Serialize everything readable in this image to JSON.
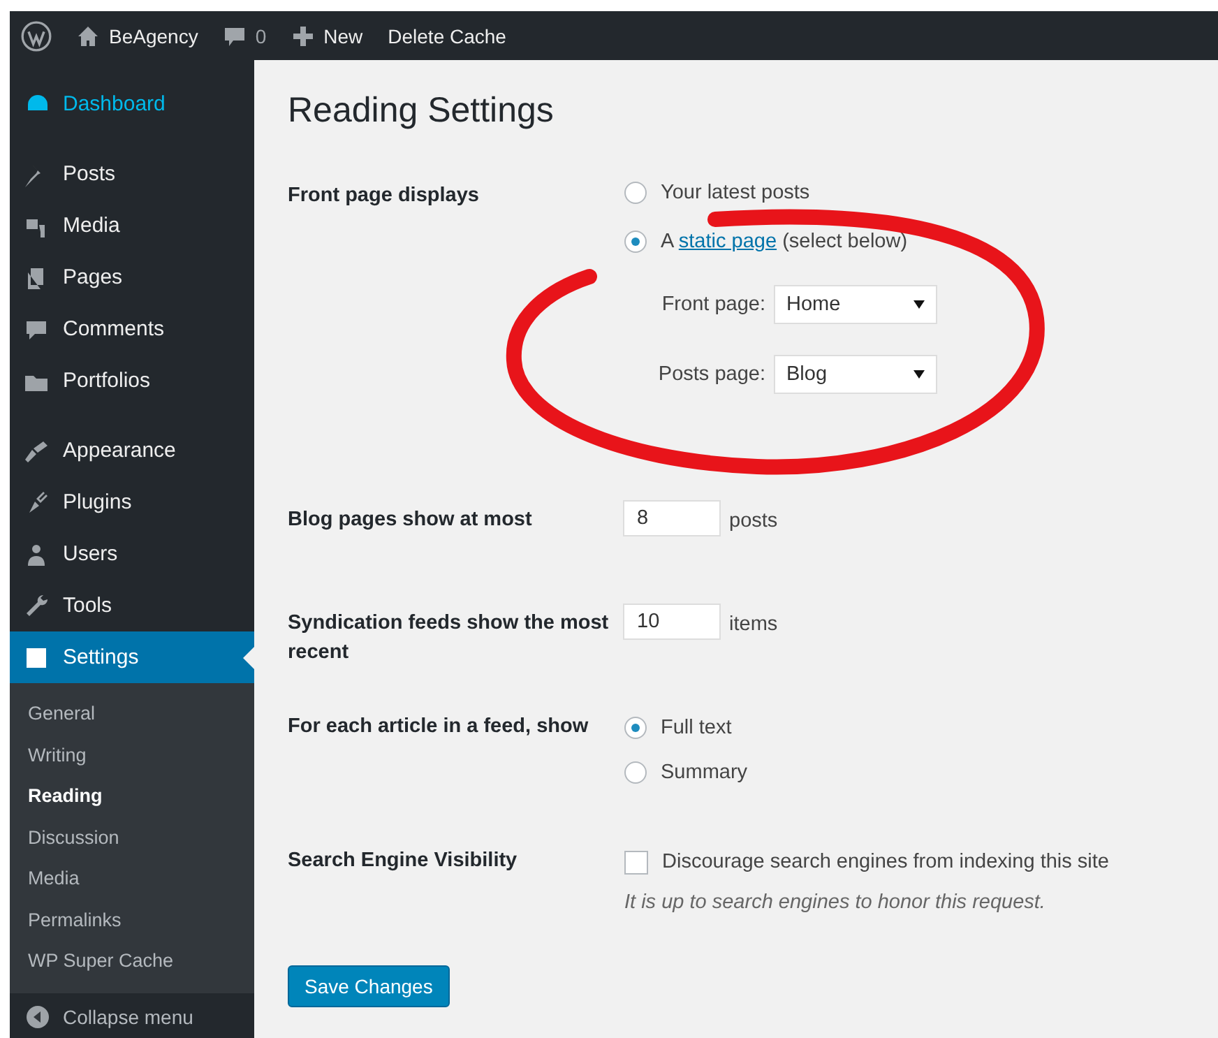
{
  "admin_bar": {
    "site": "BeAgency",
    "comments": "0",
    "new": "New",
    "items": [
      "Delete Cache"
    ]
  },
  "sidebar": {
    "groups": [
      [
        {
          "label": "Dashboard",
          "hover": true,
          "selected": false
        }
      ],
      [
        {
          "label": "Posts",
          "hover": false,
          "selected": false
        },
        {
          "label": "Media",
          "hover": false,
          "selected": false
        },
        {
          "label": "Pages",
          "hover": false,
          "selected": false
        },
        {
          "label": "Comments",
          "hover": false,
          "selected": false
        },
        {
          "label": "Portfolios",
          "hover": false,
          "selected": false
        }
      ],
      [
        {
          "label": "Appearance",
          "hover": false,
          "selected": false
        },
        {
          "label": "Plugins",
          "hover": false,
          "selected": false
        },
        {
          "label": "Users",
          "hover": false,
          "selected": false
        },
        {
          "label": "Tools",
          "hover": false,
          "selected": false
        },
        {
          "label": "Settings",
          "hover": false,
          "selected": true,
          "children": [
            {
              "label": "General",
              "selected": false
            },
            {
              "label": "Writing",
              "selected": false
            },
            {
              "label": "Reading",
              "selected": true
            },
            {
              "label": "Discussion",
              "selected": false
            },
            {
              "label": "Media",
              "selected": false
            },
            {
              "label": "Permalinks",
              "selected": false
            },
            {
              "label": "WP Super Cache",
              "selected": false
            }
          ]
        }
      ]
    ],
    "collapse": "Collapse menu"
  },
  "page": {
    "title": "Reading Settings",
    "rows": [
      {
        "kind": "front",
        "label": "Front page displays",
        "options": [
          {
            "text": "Your latest posts",
            "selected": false
          },
          {
            "prefix": "A ",
            "link": "static page",
            "suffix": " (select below)",
            "selected": true
          }
        ],
        "selects": [
          {
            "label": "Front page:",
            "value": "Home"
          },
          {
            "label": "Posts page:",
            "value": "Blog"
          }
        ]
      },
      {
        "kind": "number",
        "label": "Blog pages show at most",
        "value": "8",
        "unit": "posts"
      },
      {
        "kind": "number",
        "label": "Syndication feeds show the most recent",
        "value": "10",
        "unit": "items"
      },
      {
        "kind": "radios",
        "label": "For each article in a feed, show",
        "options": [
          {
            "text": "Full text",
            "selected": true
          },
          {
            "text": "Summary",
            "selected": false
          }
        ]
      },
      {
        "kind": "checkbox",
        "label": "Search Engine Visibility",
        "text": "Discourage search engines from indexing this site",
        "checked": false,
        "note": "It is up to search engines to honor this request."
      }
    ],
    "save": "Save Changes"
  }
}
